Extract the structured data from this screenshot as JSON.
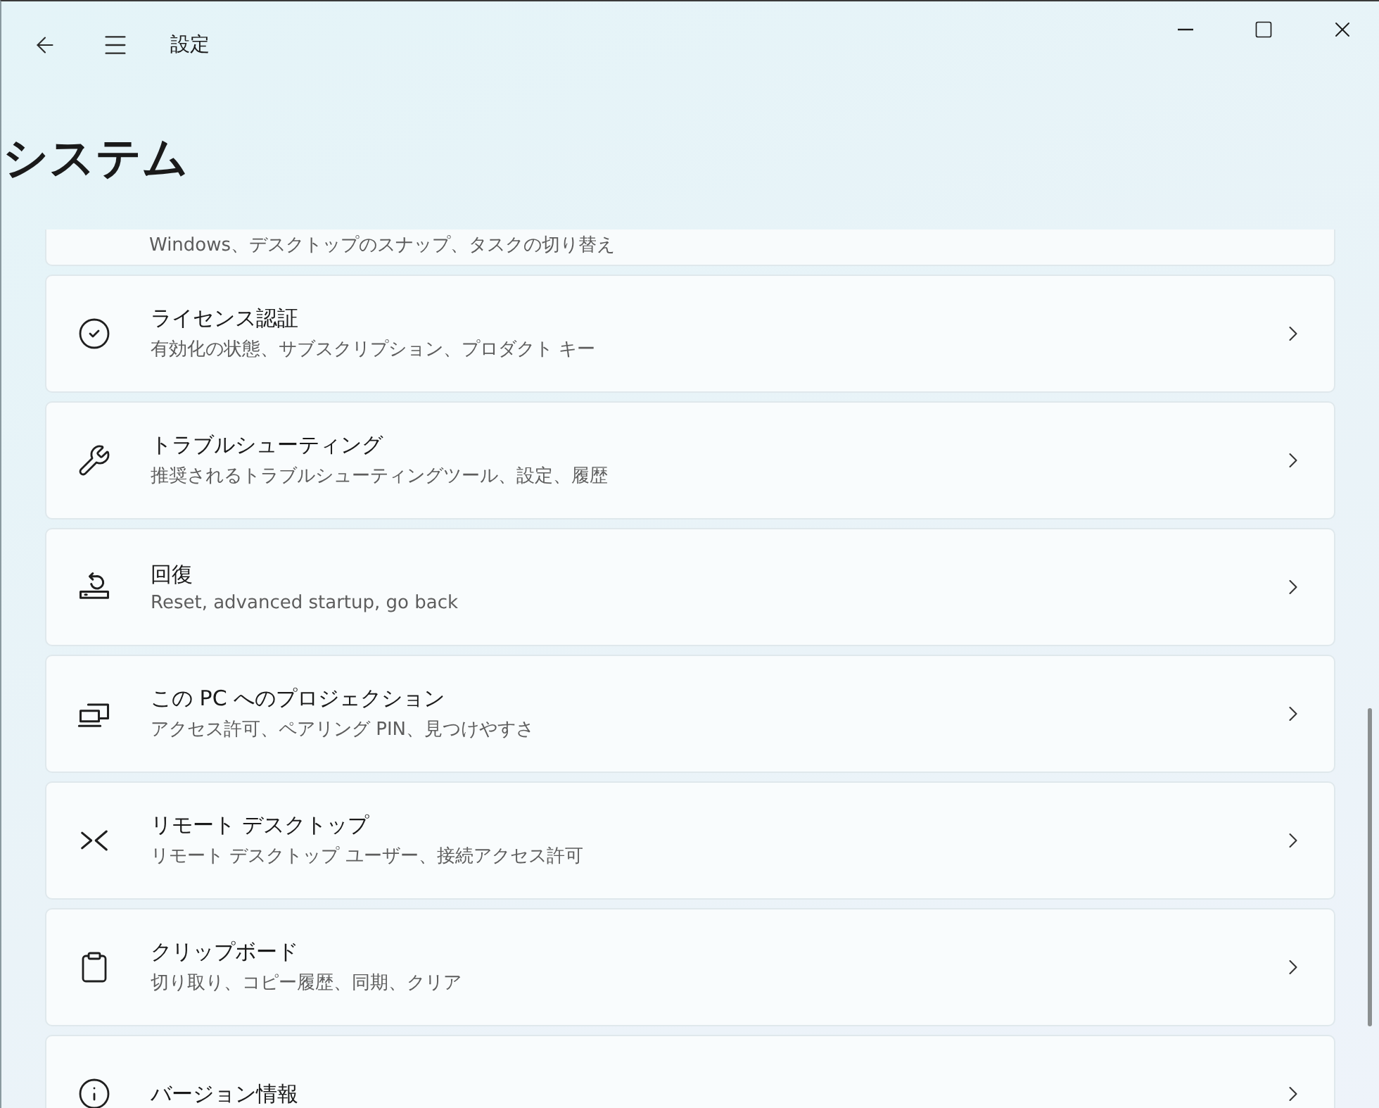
{
  "window": {
    "title": "設定"
  },
  "page": {
    "heading": "システム"
  },
  "partial_item": {
    "subtitle": "Windows、デスクトップのスナップ、タスクの切り替え"
  },
  "items": [
    {
      "title": "ライセンス認証",
      "subtitle": "有効化の状態、サブスクリプション、プロダクト キー"
    },
    {
      "title": "トラブルシューティング",
      "subtitle": "推奨されるトラブルシューティングツール、設定、履歴"
    },
    {
      "title": "回復",
      "subtitle": "Reset, advanced startup, go back"
    },
    {
      "title": "この PC へのプロジェクション",
      "subtitle": "アクセス許可、ペアリング PIN、見つけやすさ"
    },
    {
      "title": "リモート デスクトップ",
      "subtitle": "リモート デスクトップ ユーザー、接続アクセス許可"
    },
    {
      "title": "クリップボード",
      "subtitle": "切り取り、コピー履歴、同期、クリア"
    },
    {
      "title": "バージョン情報"
    }
  ]
}
